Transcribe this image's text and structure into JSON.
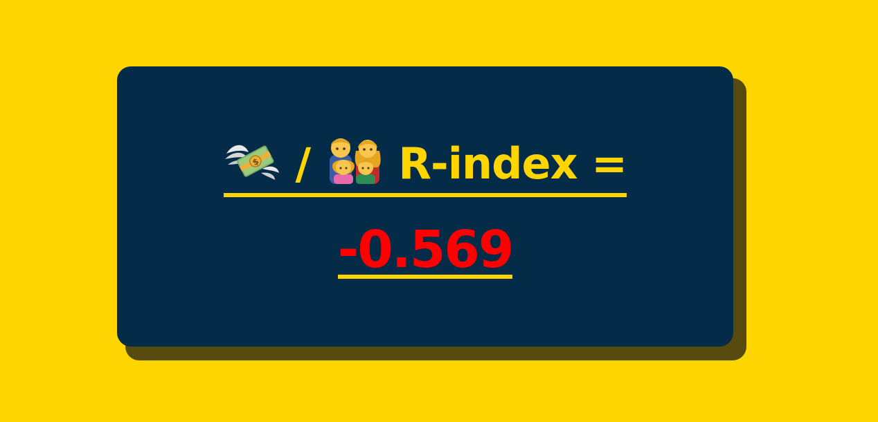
{
  "heading": {
    "money_icon_name": "money-with-wings-icon",
    "slash": "/",
    "family_icon_name": "family-icon",
    "label": "R-index ="
  },
  "value": "-0.569",
  "colors": {
    "background": "#FFD500",
    "card": "#042B48",
    "card_shadow": "#574A0E",
    "accent": "#FFD500",
    "value": "#FF0000"
  }
}
